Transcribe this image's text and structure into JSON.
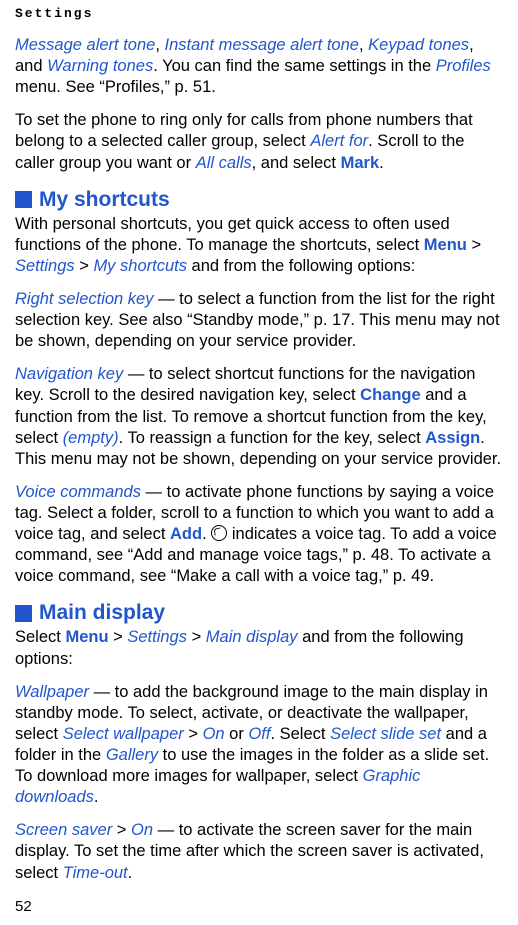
{
  "header": "Settings",
  "page_number": "52",
  "p1": {
    "t1": "Message alert tone",
    "sep1": ", ",
    "t2": "Instant message alert tone",
    "sep2": ", ",
    "t3": "Keypad tones",
    "sep3": ", and ",
    "t4": "Warning tones",
    "rest1": ". You can find the same settings in the ",
    "t5": "Profiles",
    "rest2": " menu. See “Profiles,” p. 51."
  },
  "p2": {
    "pre": "To set the phone to ring only for calls from phone numbers that belong to a selected caller group, select ",
    "t1": "Alert for",
    "mid": ". Scroll to the caller group you want or ",
    "t2": "All calls",
    "mid2": ", and select ",
    "t3": "Mark",
    "end": "."
  },
  "sec1_title": "My shortcuts",
  "p3": {
    "pre": "With personal shortcuts, you get quick access to often used functions of the phone. To manage the shortcuts, select ",
    "t1": "Menu",
    "gt1": " > ",
    "t2": "Settings",
    "gt2": " > ",
    "t3": "My shortcuts",
    "end": " and from the following options:"
  },
  "p4": {
    "t1": "Right selection key",
    "rest": " — to select a function from the list for the right selection key. See also “Standby mode,” p. 17. This menu may not be shown, depending on your service provider."
  },
  "p5": {
    "t1": "Navigation key",
    "r1": " — to select shortcut functions for the navigation key. Scroll to the desired navigation key, select ",
    "t2": "Change",
    "r2": " and a function from the list. To remove a shortcut function from the key, select ",
    "t3": "(empty)",
    "r3": ". To reassign a function for the key, select ",
    "t4": "Assign",
    "r4": ". This menu may not be shown, depending on your service provider."
  },
  "p6": {
    "t1": "Voice commands",
    "r1": " — to activate phone functions by saying a voice tag. Select a folder, scroll to a function to which you want to add a voice tag, and select ",
    "t2": "Add",
    "r2": ". ",
    "r3": " indicates a voice tag. To add a voice command, see “Add and manage voice tags,” p. 48. To activate a voice command, see “Make a call with a voice tag,” p. 49."
  },
  "sec2_title": "Main display",
  "p7": {
    "pre": "Select ",
    "t1": "Menu",
    "gt1": " > ",
    "t2": "Settings",
    "gt2": " > ",
    "t3": "Main display",
    "end": " and from the following options:"
  },
  "p8": {
    "t1": "Wallpaper",
    "r1": " — to add the background image to the main display in standby mode. To select, activate, or deactivate the wallpaper, select ",
    "t2": "Select wallpaper",
    "gt": " > ",
    "t3": "On",
    "or": " or ",
    "t4": "Off",
    "r2": ". Select ",
    "t5": "Select slide set",
    "r3": " and a folder in the ",
    "t6": "Gallery",
    "r4": " to use the images in the folder as a slide set. To download more images for wallpaper, select ",
    "t7": "Graphic downloads",
    "r5": "."
  },
  "p9": {
    "t1": "Screen saver",
    "gt": " > ",
    "t2": "On",
    "r1": " — to activate the screen saver for the main display. To set the time after which the screen saver is activated, select ",
    "t3": "Time-out",
    "r2": "."
  }
}
